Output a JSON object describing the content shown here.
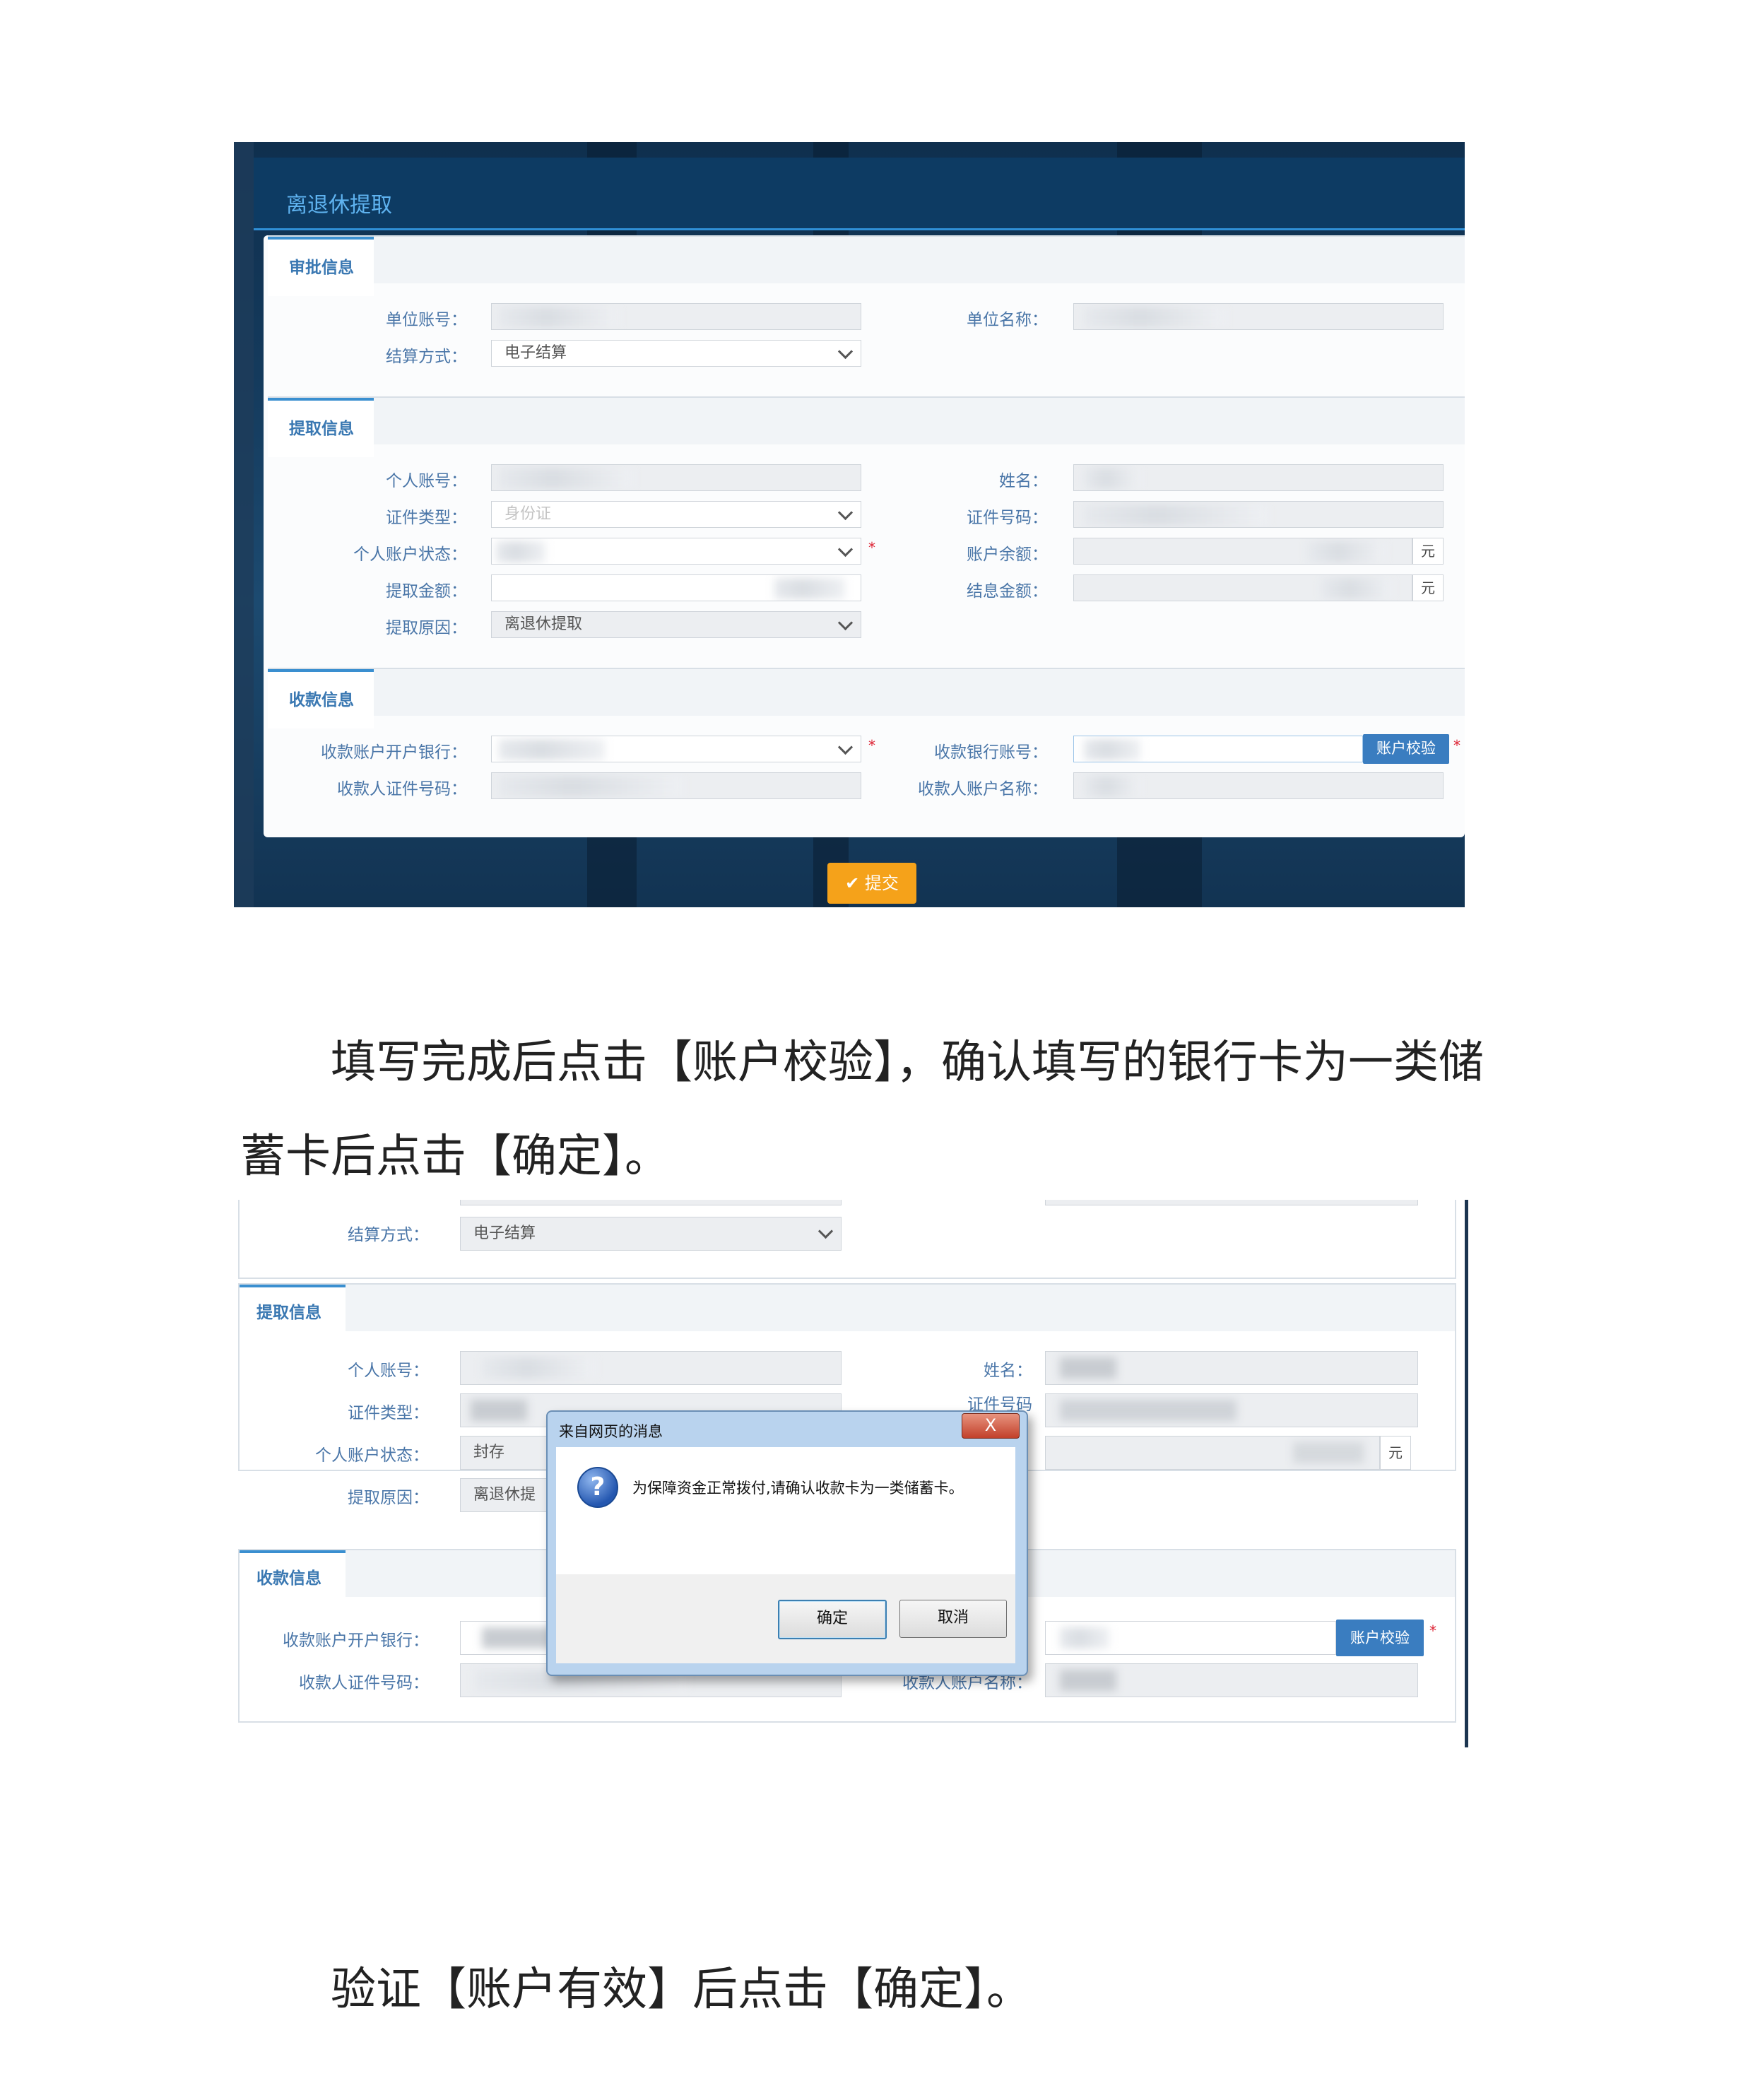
{
  "screenshot1": {
    "window_title": "离退休提取",
    "sections": {
      "approval": "审批信息",
      "withdraw": "提取信息",
      "payee": "收款信息"
    },
    "labels": {
      "unit_account": "单位账号：",
      "unit_name": "单位名称：",
      "settlement": "结算方式：",
      "personal_account": "个人账号：",
      "name": "姓名：",
      "id_type": "证件类型：",
      "id_number": "证件号码：",
      "account_status": "个人账户状态：",
      "balance": "账户余额：",
      "withdraw_amount": "提取金额：",
      "interest": "结息金额：",
      "reason": "提取原因：",
      "bank": "收款账户开户银行：",
      "bank_account": "收款银行账号：",
      "payee_id": "收款人证件号码：",
      "payee_name": "收款人账户名称："
    },
    "values": {
      "settlement": "电子结算",
      "reason": "离退休提取",
      "id_type_partial": "身份证"
    },
    "unit": "元",
    "verify_button": "账户校验",
    "submit_button": "提交",
    "submit_icon": "check-icon"
  },
  "instruction1": {
    "line1": "填写完成后点击【账户校验】，确认填写的银行卡为一类储",
    "line2": "蓄卡后点击【确定】。"
  },
  "screenshot2": {
    "labels": {
      "settlement": "结算方式：",
      "withdraw_section": "提取信息",
      "personal_account": "个人账号：",
      "name": "姓名：",
      "id_type": "证件类型：",
      "id_number": "证件号码",
      "account_status": "个人账户状态：",
      "reason": "提取原因：",
      "payee_section": "收款信息",
      "bank": "收款账户开户银行：",
      "payee_id": "收款人证件号码：",
      "payee_name": "收款人账户名称："
    },
    "values": {
      "settlement": "电子结算",
      "account_status": "封存",
      "reason": "离退休提"
    },
    "unit": "元",
    "verify_button": "账户校验",
    "dialog": {
      "caption": "来自网页的消息",
      "close": "X",
      "icon": "question-icon",
      "message": "为保障资金正常拨付,请确认收款卡为一类储蓄卡。",
      "ok": "确定",
      "cancel": "取消"
    }
  },
  "instruction2": {
    "line1": "验证【账户有效】后点击【确定】。"
  }
}
